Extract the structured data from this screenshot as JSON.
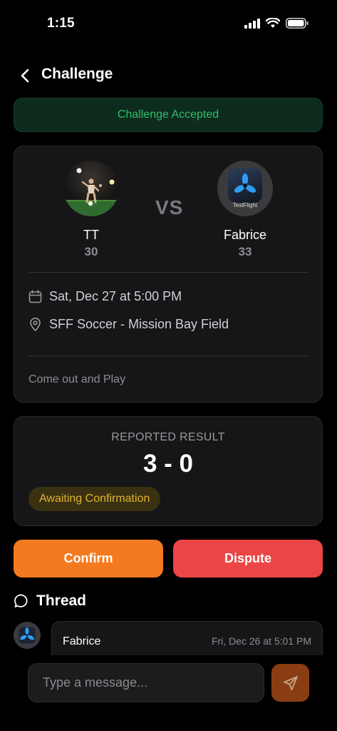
{
  "status_bar": {
    "time": "1:15"
  },
  "header": {
    "title": "Challenge"
  },
  "banner": {
    "text": "Challenge Accepted"
  },
  "match": {
    "player_left": {
      "name": "TT",
      "rating": "30"
    },
    "vs": "VS",
    "player_right": {
      "name": "Fabrice",
      "rating": "33",
      "avatar_label": "TestFlight"
    },
    "date": "Sat, Dec 27 at 5:00 PM",
    "location": "SFF Soccer - Mission Bay Field",
    "note": "Come out and Play"
  },
  "result": {
    "label": "REPORTED RESULT",
    "score": "3 - 0",
    "status": "Awaiting Confirmation"
  },
  "actions": {
    "confirm": "Confirm",
    "dispute": "Dispute"
  },
  "thread": {
    "title": "Thread",
    "messages": [
      {
        "author": "Fabrice",
        "time": "Fri, Dec 26 at 5:01 PM",
        "avatar_label": "TestFlight"
      }
    ]
  },
  "composer": {
    "placeholder": "Type a message..."
  },
  "colors": {
    "background": "#000000",
    "card": "#161618",
    "accepted_green": "#2fbf6b",
    "confirm_orange": "#f47a1f",
    "dispute_red": "#eb4545",
    "pending_yellow": "#e0b330"
  }
}
